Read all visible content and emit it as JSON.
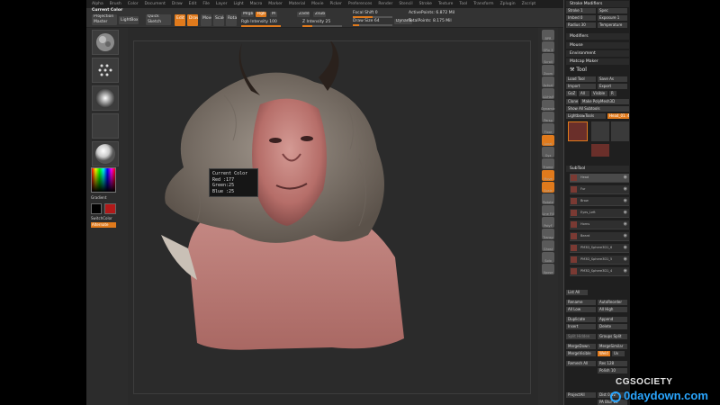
{
  "menubar": [
    "Alpha",
    "Brush",
    "Color",
    "Document",
    "Draw",
    "Edit",
    "File",
    "Layer",
    "Light",
    "Macro",
    "Marker",
    "Material",
    "Movie",
    "Picker",
    "Preferences",
    "Render",
    "Stencil",
    "Stroke",
    "Texture",
    "Tool",
    "Transform",
    "Zplugin",
    "Zscript"
  ],
  "top": {
    "current_color_label": "Current Color",
    "projection_master": "Projection Master",
    "lightbox": "LightBox",
    "quick_sketch": "Quick Sketch",
    "edit": "Edit",
    "draw": "Draw",
    "move": "Move",
    "scale": "Scale",
    "rotate": "Rotate",
    "mrgb": "Mrgb",
    "rgb": "Rgb",
    "m": "M",
    "rgb_intensity": "Rgb Intensity 100",
    "zadd": "Zadd",
    "zsub": "Zsub",
    "z_intensity": "Z Intensity 25",
    "focal_shift": "Focal Shift 0",
    "draw_size": "Draw Size 64",
    "dynamic": "Dynamic",
    "active_points": "ActivePoints: 6.872 Mil",
    "total_points": "TotalPoints: 8.175 Mil"
  },
  "left": {
    "gradient": "Gradient",
    "switch_color": "SwitchColor",
    "alternate": "Alternate"
  },
  "tooltip": {
    "title": "Current Color",
    "red": "Red :177",
    "green": "Green:25",
    "blue": "Blue :25"
  },
  "right_shelf": [
    "BPR",
    "SPix 3",
    "Scroll",
    "Zoom",
    "Actual",
    "AAHalf",
    "Dynamic",
    "Persp",
    "Floor",
    "Local",
    "Gyz",
    "Frame",
    "Move",
    "Scale",
    "Rotate",
    "Line Fill",
    "PolyF",
    "Transp",
    "Ghost",
    "Solo",
    "Xpose"
  ],
  "tray": {
    "stroke_modifiers": "Stroke Modifiers",
    "stroke": "Stroke 1",
    "spec": "Spec",
    "imbed": "Imbed 0",
    "exposure": "Exposure 1",
    "radius": "Radius 30",
    "temperature": "Temperature",
    "modifiers": "Modifiers",
    "mouse": "Mouse",
    "environment": "Environment",
    "matcap_maker": "Matcap Maker",
    "tool_title": "Tool",
    "load_tool": "Load Tool",
    "save_as": "Save As",
    "import": "Import",
    "export": "Export",
    "goz": "GoZ",
    "all": "All",
    "visible": "Visible",
    "r": "R",
    "clone": "Clone",
    "make_polymesh": "Make PolyMesh3D",
    "show_all_subtools": "Show All Subtools",
    "lightbox_tools": "Lightbox▸Tools",
    "head": "Head_01. 48",
    "r_btn": "R",
    "subtool": "SubTool",
    "list_all": "List All",
    "rename": "Rename",
    "autoreorder": "AutoReorder",
    "all_low": "All Low",
    "all_high": "All High",
    "duplicate": "Duplicate",
    "append": "Append",
    "insert": "Insert",
    "delete": "Delete",
    "split_hidden": "Split Hidden",
    "groups_split": "Groups Split",
    "mergedown": "MergeDown",
    "mergesimilar": "MergeSimilar",
    "mergevisible": "MergeVisible",
    "weld": "Weld",
    "uv": "Uv",
    "remesh_all": "Remesh All",
    "res": "Res 128",
    "polish": "Polish 10",
    "project_all": "ProjectAll",
    "dist": "Dist 0.02",
    "mean": "Mean",
    "pa_blur": "PA Blur 10"
  },
  "subtools": [
    "Head",
    "Fur",
    "Brow",
    "Eyes_Left",
    "Horns",
    "Beard",
    "PM3D_Sphere3D1_6",
    "PM3D_Sphere3D1_5",
    "PM3D_Sphere3D1_4"
  ],
  "watermark": {
    "brand": "CGSOCIETY",
    "site": "0daydown.com"
  },
  "colors": {
    "accent": "#e07a1c",
    "current_color": "#b11919",
    "panel": "#2a2a2a"
  }
}
